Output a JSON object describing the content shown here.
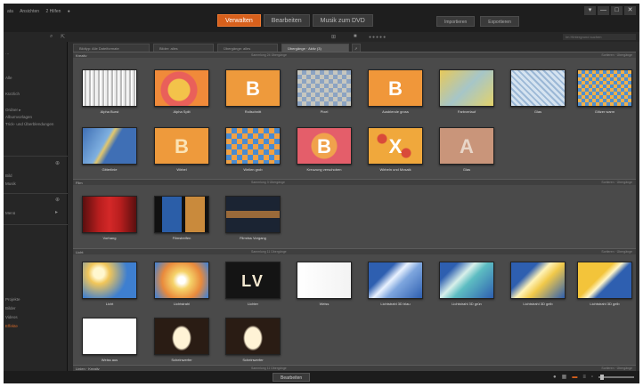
{
  "titlebar": {
    "menu": [
      "ata",
      "Ansichten",
      "2 Hilfen"
    ]
  },
  "modetabs": [
    {
      "label": "Verwalten",
      "active": true
    },
    {
      "label": "Bearbeiten",
      "active": false
    },
    {
      "label": "Musik zum DVD",
      "active": false
    }
  ],
  "right_buttons": [
    "Importieren",
    "Exportieren"
  ],
  "window_controls": [
    "▾",
    "—",
    "□",
    "✕"
  ],
  "toolbar": {
    "search_placeholder": "Im Hintergrund suchen"
  },
  "sidebar": {
    "items": [
      "…",
      "Alle",
      "Kürzlich",
      "Ordner  ▸",
      "Albumvorlagen",
      "Trick- und Überblendungen",
      "Bild",
      "Musik",
      "Menü",
      "Projekte",
      "Bilder",
      "Videos",
      "Übergänge"
    ],
    "orange_item": "Effekte"
  },
  "content_tabs": [
    {
      "label": "Bildtyp: Alle Dateiformate",
      "active": false
    },
    {
      "label": "Bilder: alles",
      "active": false
    },
    {
      "label": "Übergänge: alles",
      "active": false
    },
    {
      "label": "Übergänge · Aktiv (3)",
      "active": true
    }
  ],
  "sections": [
    {
      "label": "Kreativ",
      "count": "Sammlung 24 Übergänge",
      "right": "Sortieren · Übergänge"
    },
    {
      "label": "Film",
      "count": "Sammlung 3 Übergänge",
      "right": "Sortieren · Übergänge"
    },
    {
      "label": "Licht",
      "count": "Sammlung 11 Übergänge",
      "right": "Sortieren · Übergänge"
    },
    {
      "label": "Linien · Kreativ",
      "count": "Sammlung 11 Übergänge",
      "right": "Sortieren · Übergänge"
    }
  ],
  "tiles": {
    "kreativ_row1": [
      "Alpha Burst",
      "Alpha Split",
      "Rollschnitt",
      "Pixel",
      "Ausblende gross",
      "Farbverlauf",
      "Glas",
      "Glitzer warm"
    ],
    "kreativ_row2": [
      "Gitterlinie",
      "Wirbel",
      "Wellen grob",
      "Kreuzung verschoben",
      "Wirbeln und Mosaik",
      "Glas"
    ],
    "film": [
      "Vorhang",
      "Filmstreifen",
      "Filmriss Vorgang"
    ],
    "licht_row1": [
      "Licht",
      "Lichtstrahl",
      "Lichter",
      "Weiss",
      "Lichtstrahl 3D blau",
      "Lichtstrahl 3D grün",
      "Lichtstrahl 3D gelb",
      "Lichtstrahl 3D gelb"
    ],
    "licht_row2": [
      "Weiss aus",
      "Scheinwerfer",
      "Scheinwerfer"
    ]
  },
  "film_letters": "LV",
  "tile_letters": {
    "rollschnitt": "B",
    "ausblende": "B",
    "wirbel": "B",
    "kreuz": "B",
    "mosaik": "X",
    "glas": "A"
  },
  "statusbar": {
    "tab": "Bearbeiten"
  },
  "colors": {
    "accent": "#d7601c",
    "bg": "#4a4a4a"
  }
}
